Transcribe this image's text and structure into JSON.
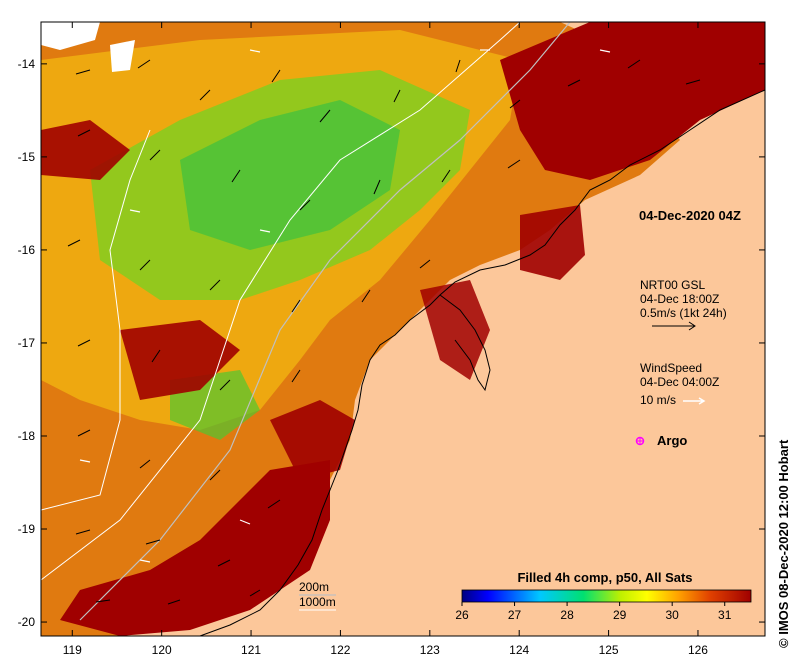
{
  "map": {
    "title": "04-Dec-2020 04Z",
    "lon_ticks": [
      "119",
      "120",
      "121",
      "122",
      "123",
      "124",
      "125",
      "126"
    ],
    "lat_ticks": [
      "-14",
      "-15",
      "-16",
      "-17",
      "-18",
      "-19",
      "-20"
    ],
    "lon_range": [
      118.65,
      126.75
    ],
    "lat_range": [
      -20.15,
      -13.55
    ]
  },
  "legend": {
    "currents": {
      "title": "NRT00 GSL",
      "time": "04-Dec 18:00Z",
      "scale": "0.5m/s (1kt 24h)"
    },
    "wind": {
      "title": "WindSpeed",
      "time": "04-Dec 04:00Z",
      "scale": "10 m/s"
    },
    "argo": {
      "label": "Argo",
      "color": "#ff00ff"
    },
    "isobaths": [
      "200m",
      "1000m"
    ]
  },
  "colorbar": {
    "title": "Filled 4h comp, p50, All Sats",
    "ticks": [
      "26",
      "27",
      "28",
      "29",
      "30",
      "31"
    ],
    "range": [
      26,
      31.5
    ],
    "colors": [
      "#00007f",
      "#0000ff",
      "#0080ff",
      "#00d0ff",
      "#00e070",
      "#40e000",
      "#c0f000",
      "#ffff00",
      "#ffc000",
      "#ff8000",
      "#e04000",
      "#a00000"
    ]
  },
  "credit": "IMOS 08-Dec-2020 12:00 Hobart",
  "colors": {
    "land": "#fcc79a",
    "frame": "#000000"
  }
}
